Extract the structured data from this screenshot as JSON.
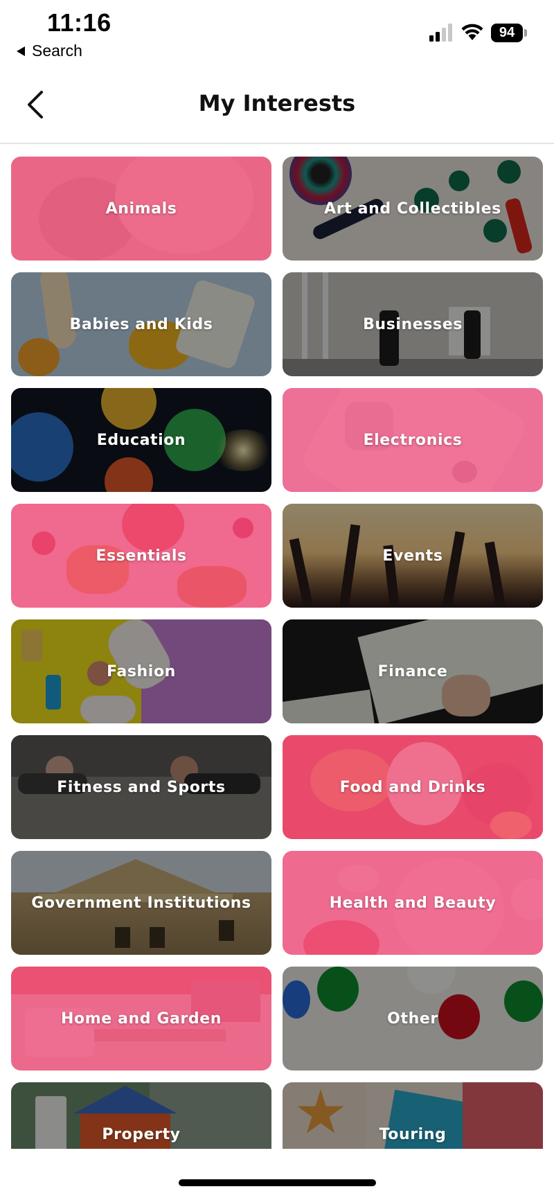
{
  "status_bar": {
    "time": "11:16",
    "back_app_label": "Search",
    "battery": "94"
  },
  "header": {
    "title": "My Interests",
    "back_icon": "chevron-left-icon"
  },
  "interests": [
    {
      "label": "Animals",
      "tint": "pink"
    },
    {
      "label": "Art and Collectibles",
      "tint": "dark"
    },
    {
      "label": "Babies and Kids",
      "tint": "dark"
    },
    {
      "label": "Businesses",
      "tint": "dark"
    },
    {
      "label": "Education",
      "tint": "dark"
    },
    {
      "label": "Electronics",
      "tint": "pink"
    },
    {
      "label": "Essentials",
      "tint": "pink"
    },
    {
      "label": "Events",
      "tint": "dark"
    },
    {
      "label": "Fashion",
      "tint": "dark"
    },
    {
      "label": "Finance",
      "tint": "dark"
    },
    {
      "label": "Fitness and Sports",
      "tint": "dark"
    },
    {
      "label": "Food and Drinks",
      "tint": "pink"
    },
    {
      "label": "Government Institutions",
      "tint": "dark"
    },
    {
      "label": "Health and Beauty",
      "tint": "pink"
    },
    {
      "label": "Home and Garden",
      "tint": "pink"
    },
    {
      "label": "Other",
      "tint": "dark"
    },
    {
      "label": "Property",
      "tint": "dark"
    },
    {
      "label": "Touring",
      "tint": "dark"
    }
  ],
  "colors": {
    "pink_overlay": "#ee507d",
    "title_text": "#111111"
  }
}
